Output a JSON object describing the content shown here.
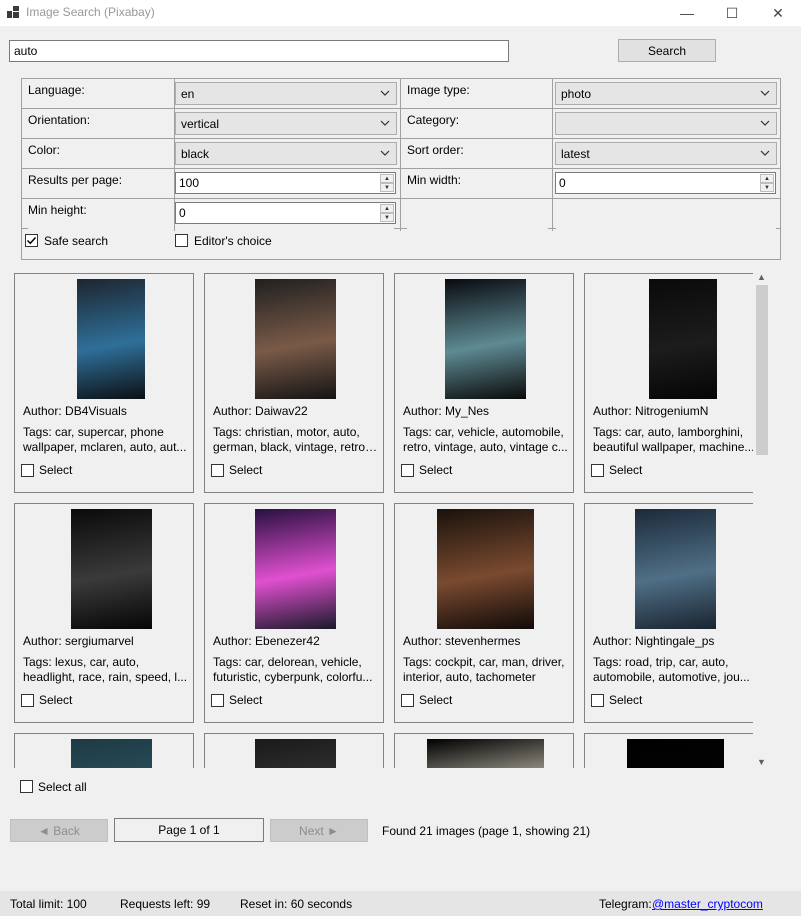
{
  "window": {
    "title": "Image Search (Pixabay)",
    "minimize": "—",
    "maximize": "☐",
    "close": "✕"
  },
  "search": {
    "query": "auto",
    "button_label": "Search"
  },
  "filters": {
    "language_label": "Language:",
    "language_value": "en",
    "image_type_label": "Image type:",
    "image_type_value": "photo",
    "orientation_label": "Orientation:",
    "orientation_value": "vertical",
    "category_label": "Category:",
    "category_value": "",
    "color_label": "Color:",
    "color_value": "black",
    "sort_label": "Sort order:",
    "sort_value": "latest",
    "per_page_label": "Results per page:",
    "per_page_value": "100",
    "min_width_label": "Min width:",
    "min_width_value": "0",
    "min_height_label": "Min height:",
    "min_height_value": "0",
    "safe_search_label": "Safe search",
    "safe_search_checked": true,
    "editors_choice_label": "Editor's choice",
    "editors_choice_checked": false
  },
  "results": [
    {
      "author": "Author: DB4Visuals",
      "tags1": "Tags: car, supercar, phone",
      "tags2": "wallpaper, mclaren, auto, aut...",
      "select": "Select",
      "thumb_colors": [
        "#1d2630",
        "#2f6f99",
        "#0c1014"
      ]
    },
    {
      "author": "Author: Daiwav22",
      "tags1": "Tags: christian, motor, auto,",
      "tags2": "german, black, vintage, retro,...",
      "select": "Select",
      "thumb_colors": [
        "#202020",
        "#7a5a48",
        "#141414"
      ]
    },
    {
      "author": "Author: My_Nes",
      "tags1": "Tags: car, vehicle, automobile,",
      "tags2": "retro, vintage, auto, vintage c...",
      "select": "Select",
      "thumb_colors": [
        "#080b10",
        "#5e8a93",
        "#0a0a0a"
      ]
    },
    {
      "author": "Author: NitrogeniumN",
      "tags1": "Tags: car, auto, lamborghini,",
      "tags2": "beautiful wallpaper, machine...",
      "select": "Select",
      "thumb_colors": [
        "#0a0a0a",
        "#1c1c1c",
        "#050505"
      ]
    },
    {
      "author": "Author: sergiumarvel",
      "tags1": "Tags: lexus, car, auto,",
      "tags2": "headlight, race, rain, speed, l...",
      "select": "Select",
      "thumb_colors": [
        "#0a0a0a",
        "#3a3a3a",
        "#060606"
      ]
    },
    {
      "author": "Author: Ebenezer42",
      "tags1": "Tags: car, delorean, vehicle,",
      "tags2": "futuristic, cyberpunk, colorfu...",
      "select": "Select",
      "thumb_colors": [
        "#281040",
        "#e050d0",
        "#1a1a2a"
      ]
    },
    {
      "author": "Author: stevenhermes",
      "tags1": "Tags: cockpit, car, man, driver,",
      "tags2": "interior, auto, tachometer",
      "select": "Select",
      "thumb_colors": [
        "#1a120c",
        "#7a4a30",
        "#100a08"
      ]
    },
    {
      "author": "Author: Nightingale_ps",
      "tags1": "Tags: road, trip, car, auto,",
      "tags2": "automobile, automotive, jou...",
      "select": "Select",
      "thumb_colors": [
        "#1c2a3a",
        "#4f6f86",
        "#1a2430"
      ]
    },
    {
      "author": "",
      "tags1": "",
      "tags2": "",
      "select": "",
      "thumb_colors": [
        "#1e3a44",
        "#2b5563",
        "#12232a"
      ]
    },
    {
      "author": "",
      "tags1": "",
      "tags2": "",
      "select": "",
      "thumb_colors": [
        "#1a1a1a",
        "#3a3a3a",
        "#111111"
      ]
    },
    {
      "author": "",
      "tags1": "",
      "tags2": "",
      "select": "",
      "thumb_colors": [
        "#000000",
        "#d8d2c2",
        "#000000"
      ]
    },
    {
      "author": "",
      "tags1": "",
      "tags2": "",
      "select": "",
      "thumb_colors": [
        "#000000",
        "#050505",
        "#000000"
      ]
    }
  ],
  "select_all_label": "Select all",
  "pager": {
    "back_label": "◄ Back",
    "page_label": "Page 1 of 1",
    "next_label": "Next ►",
    "found_text": "Found 21 images (page 1, showing 21)"
  },
  "status": {
    "total_limit": "Total limit: 100",
    "requests_left": "Requests left: 99",
    "reset_in": "Reset in: 60 seconds",
    "telegram_label": "Telegram:",
    "telegram_link": "@master_cryptocom"
  }
}
